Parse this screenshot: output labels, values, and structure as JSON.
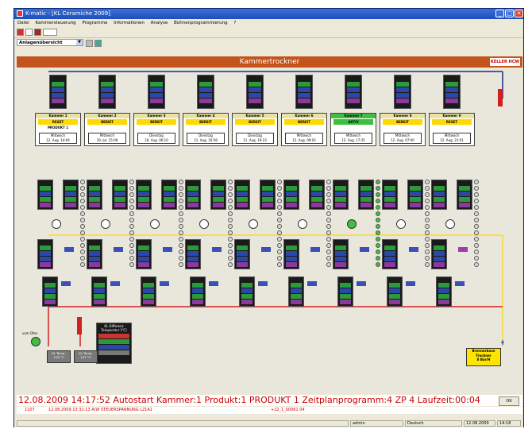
{
  "window": {
    "title": "K-matic - [KL Ceramiche 2009]",
    "buttons": {
      "minimize": "_",
      "maximize": "□",
      "close": "✕"
    }
  },
  "menu": [
    "Datei",
    "Kammersteuerung",
    "Programme",
    "Informationen",
    "Analyse",
    "Bühnenprogrammierung",
    "?"
  ],
  "view_select": {
    "value": "Anlagenübersicht"
  },
  "header": {
    "title": "Kammertrockner",
    "logo": "KELLER HCW"
  },
  "chambers": [
    {
      "name": "Kammer 1",
      "status": "RESET",
      "product": "PRODUKT 1",
      "day": "Mittwoch",
      "date": "12. Aug. 14:04",
      "active": false
    },
    {
      "name": "Kammer 2",
      "status": "BEREIT",
      "product": "",
      "day": "Mittwoch",
      "date": "19. Jul. 15:08",
      "active": false
    },
    {
      "name": "Kammer 3",
      "status": "BEREIT",
      "product": "",
      "day": "Dienstag",
      "date": "18. Aug. 06:10",
      "active": false
    },
    {
      "name": "Kammer 4",
      "status": "BEREIT",
      "product": "",
      "day": "Dienstag",
      "date": "11. Aug. 16:58",
      "active": false
    },
    {
      "name": "Kammer 5",
      "status": "BEREIT",
      "product": "",
      "day": "Dienstag",
      "date": "11. Aug. 19:23",
      "active": false
    },
    {
      "name": "Kammer 6",
      "status": "BEREIT",
      "product": "",
      "day": "Mittwoch",
      "date": "12. Aug. 09:02",
      "active": false
    },
    {
      "name": "Kammer 7",
      "status": "AKTIV",
      "product": "",
      "day": "Mittwoch",
      "date": "12. Aug. 17:35",
      "active": true
    },
    {
      "name": "Kammer 8",
      "status": "BEREIT",
      "product": "",
      "day": "Mittwoch",
      "date": "12. Aug. 07:00",
      "active": false
    },
    {
      "name": "Kammer 9",
      "status": "RESET",
      "product": "",
      "day": "Mittwoch",
      "date": "12. Aug. 21:01",
      "active": false
    }
  ],
  "legend": {
    "title": "KL Differenz Temperatur [°C]"
  },
  "pump": {
    "label": "vom Ofen"
  },
  "small_boxes": [
    {
      "line1": "KL Temp.",
      "line2": "116 °C"
    },
    {
      "line1": "KL Temp.",
      "line2": "102 °C"
    }
  ],
  "yellow_box": {
    "line1": "Brennerboxe",
    "line2": "Trockner",
    "line3": "8 Bar/H"
  },
  "status_message": "12.08.2009 14:17:52 Autostart Kammer:1 Produkt:1 PRODUKT 1 Zeitplanprogramm:4 ZP 4 Laufzeit:00:04",
  "ok_label": "OK",
  "alarm": {
    "code": "1107",
    "text": "12.08.2009 13:31:13 A/W STEUERSPANNUNG L21A1",
    "ref": "+22_1_S0061 04"
  },
  "statusbar": {
    "user": "admin",
    "language": "Deutsch",
    "date": "12.08.2009",
    "time": "14:18"
  }
}
